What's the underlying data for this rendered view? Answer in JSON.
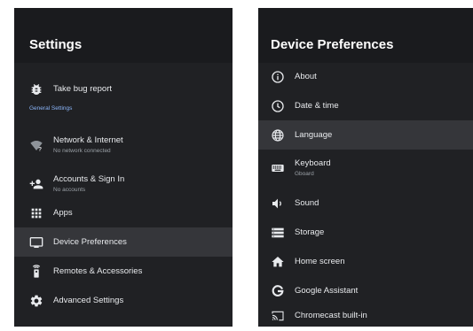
{
  "colors": {
    "panel_bg": "#202124",
    "header_bg": "#1a1b1e",
    "selected_bg": "#35363a",
    "text": "#e8eaed",
    "subtext": "#9aa0a6",
    "accent": "#8ab4f8"
  },
  "settings": {
    "title": "Settings",
    "bug_report": {
      "label": "Take bug report",
      "icon": "bug-icon"
    },
    "section_header": "General Settings",
    "items": [
      {
        "label": "Network & Internet",
        "sublabel": "No network connected",
        "icon": "wifi-off-icon"
      },
      {
        "label": "Accounts & Sign In",
        "sublabel": "No accounts",
        "icon": "person-add-icon"
      },
      {
        "label": "Apps",
        "icon": "apps-grid-icon"
      },
      {
        "label": "Device Preferences",
        "icon": "tv-icon",
        "selected": true
      },
      {
        "label": "Remotes & Accessories",
        "icon": "remote-icon"
      },
      {
        "label": "Advanced Settings",
        "icon": "gear-icon"
      }
    ]
  },
  "device_preferences": {
    "title": "Device Preferences",
    "items": [
      {
        "label": "About",
        "icon": "info-icon"
      },
      {
        "label": "Date & time",
        "icon": "clock-icon"
      },
      {
        "label": "Language",
        "icon": "globe-icon",
        "selected": true
      },
      {
        "label": "Keyboard",
        "sublabel": "Gboard",
        "icon": "keyboard-icon"
      },
      {
        "label": "Sound",
        "icon": "speaker-icon"
      },
      {
        "label": "Storage",
        "icon": "storage-icon"
      },
      {
        "label": "Home screen",
        "icon": "home-icon"
      },
      {
        "label": "Google Assistant",
        "icon": "google-g-icon"
      },
      {
        "label": "Chromecast built-in",
        "icon": "cast-icon"
      }
    ]
  }
}
